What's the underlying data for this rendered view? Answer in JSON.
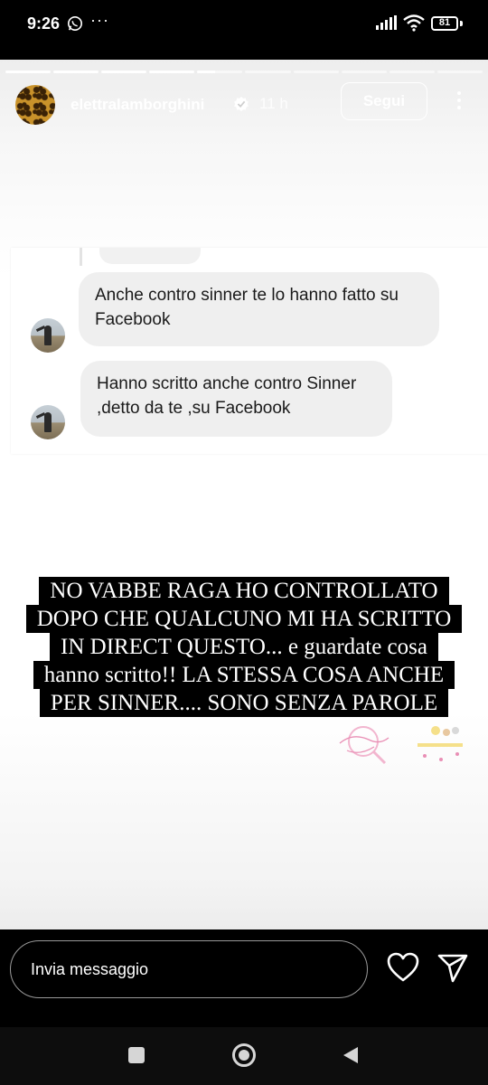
{
  "status_bar": {
    "time": "9:26",
    "more_indicator": "···",
    "battery_level": "81",
    "icons": [
      "whatsapp-icon",
      "signal-icon",
      "wifi-icon",
      "battery-icon"
    ]
  },
  "story": {
    "progress": {
      "segments": 10,
      "current_segment": 4,
      "current_progress": 0.4
    },
    "username": "elettralamborghini",
    "verified": true,
    "time_ago": "11 h",
    "follow_label": "Segui",
    "chat": {
      "messages": [
        "Anche contro sinner te lo hanno fatto su Facebook",
        "Hanno scritto anche contro Sinner ,detto da te ,su Facebook"
      ]
    },
    "caption_lines": [
      "NO VABBE RAGA HO CONTROLLATO",
      "DOPO CHE QUALCUNO MI HA SCRITTO",
      "IN DIRECT QUESTO... e guardate cosa",
      "hanno scritto!! LA STESSA COSA ANCHE",
      "PER SINNER.... SONO SENZA PAROLE"
    ]
  },
  "bottom_bar": {
    "message_placeholder": "Invia messaggio",
    "icons": [
      "heart-icon",
      "send-icon"
    ]
  },
  "nav_bar": {
    "icons": [
      "recent-apps-icon",
      "home-icon",
      "back-icon"
    ]
  },
  "colors": {
    "background": "#000000",
    "bubble": "#efefef",
    "caption_bg": "#000000",
    "text_dark": "#1a1a1a"
  }
}
